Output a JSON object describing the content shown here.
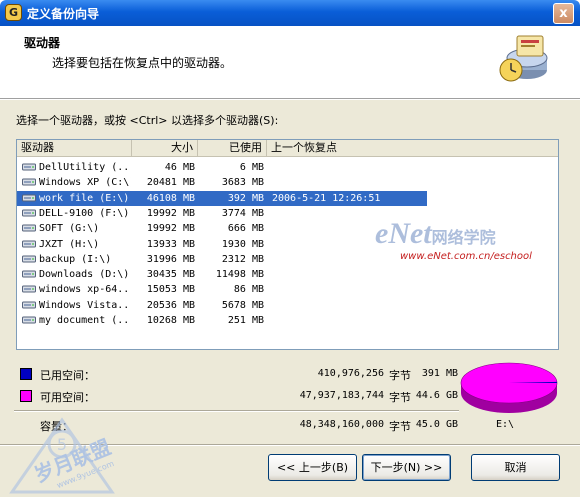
{
  "window": {
    "title": "定义备份向导",
    "close_glyph": "x"
  },
  "header": {
    "title": "驱动器",
    "subtitle": "选择要包括在恢复点中的驱动器。"
  },
  "instruction": "选择一个驱动器，或按 <Ctrl> 以选择多个驱动器(S):",
  "list": {
    "columns": [
      "驱动器",
      "大小",
      "已使用",
      "上一个恢复点"
    ],
    "rows": [
      {
        "name": "DellUtility (...",
        "size": "46 MB",
        "used": "6 MB",
        "restore": ""
      },
      {
        "name": "Windows XP (C:\\)",
        "size": "20481 MB",
        "used": "3683 MB",
        "restore": ""
      },
      {
        "name": "work file (E:\\)",
        "size": "46108 MB",
        "used": "392 MB",
        "restore": "2006-5-21 12:26:51"
      },
      {
        "name": "DELL-9100 (F:\\)",
        "size": "19992 MB",
        "used": "3774 MB",
        "restore": ""
      },
      {
        "name": "SOFT (G:\\)",
        "size": "19992 MB",
        "used": "666 MB",
        "restore": ""
      },
      {
        "name": "JXZT (H:\\)",
        "size": "13933 MB",
        "used": "1930 MB",
        "restore": ""
      },
      {
        "name": "backup (I:\\)",
        "size": "31996 MB",
        "used": "2312 MB",
        "restore": ""
      },
      {
        "name": "Downloads (D:\\)",
        "size": "30435 MB",
        "used": "11498 MB",
        "restore": ""
      },
      {
        "name": "windows xp-64...",
        "size": "15053 MB",
        "used": "86 MB",
        "restore": ""
      },
      {
        "name": "Windows Vista...",
        "size": "20536 MB",
        "used": "5678 MB",
        "restore": ""
      },
      {
        "name": "my document (...",
        "size": "10268 MB",
        "used": "251 MB",
        "restore": ""
      }
    ],
    "selected_index": 2
  },
  "summary": {
    "used_label": "已用空间：",
    "used_bytes": "410,976,256",
    "used_unit": "字节",
    "used_size": "391 MB",
    "free_label": "可用空间：",
    "free_bytes": "47,937,183,744",
    "free_unit": "字节",
    "free_size": "44.6 GB",
    "capacity_label": "容量：",
    "capacity_bytes": "48,348,160,000",
    "capacity_unit": "字节",
    "capacity_size": "45.0 GB",
    "drive_letter": "E:\\",
    "used_fraction": 0.0085,
    "colors": {
      "used": "#0000c0",
      "free": "#ff00ff"
    }
  },
  "buttons": {
    "back": "<< 上一步(B)",
    "next": "下一步(N) >>",
    "cancel": "取消"
  },
  "watermarks": {
    "enet": "eNet",
    "enet_cn": "网络学院",
    "enet_url": "www.eNet.com.cn/eschool",
    "stamp": "岁月联盟",
    "stamp_sub": "www.9yue.com"
  }
}
